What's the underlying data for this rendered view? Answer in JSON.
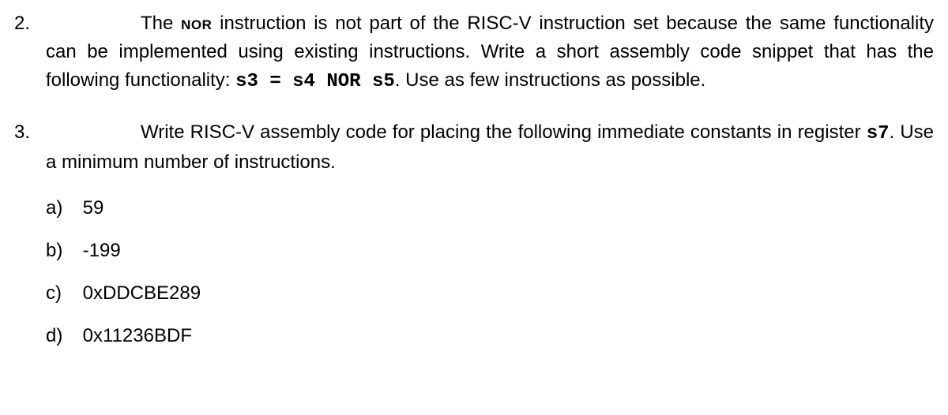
{
  "q2": {
    "number": "2.",
    "lead": "The ",
    "nor": "nor",
    "mid1": " instruction is not part of the RISC-V instruction set because the same functionality can be implemented using existing instructions. Write a short assembly code snippet that has the following functionality: ",
    "code": "s3 = s4 NOR s5",
    "mid2": ". Use as few instructions as possible."
  },
  "q3": {
    "number": "3.",
    "lead": "Write RISC-V assembly code for placing the following immediate constants in register ",
    "reg": "s7",
    "tail": ". Use a minimum number of instructions.",
    "items": [
      {
        "label": "a)",
        "value": "59"
      },
      {
        "label": "b)",
        "value": "-199"
      },
      {
        "label": "c)",
        "value": "0xDDCBE289"
      },
      {
        "label": "d)",
        "value": "0x11236BDF"
      }
    ]
  }
}
